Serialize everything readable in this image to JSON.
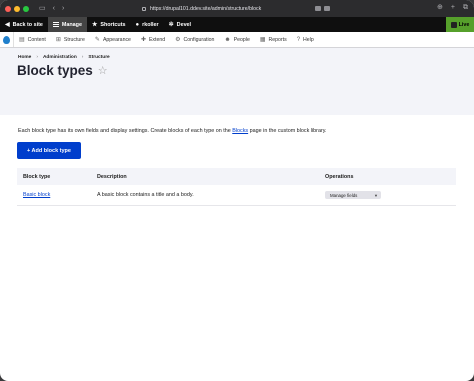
{
  "browser": {
    "url": "https://drupal101.ddev.site/admin/structure/block"
  },
  "toolbar": {
    "back_label": "Back to site",
    "manage_label": "Manage",
    "shortcuts_label": "Shortcuts",
    "user_label": "rkoller",
    "devel_label": "Devel",
    "live_label": "Live"
  },
  "admin_menu": [
    {
      "label": "Content",
      "icon": "content-icon"
    },
    {
      "label": "Structure",
      "icon": "structure-icon"
    },
    {
      "label": "Appearance",
      "icon": "appearance-icon"
    },
    {
      "label": "Extend",
      "icon": "extend-icon"
    },
    {
      "label": "Configuration",
      "icon": "configuration-icon"
    },
    {
      "label": "People",
      "icon": "people-icon"
    },
    {
      "label": "Reports",
      "icon": "reports-icon"
    },
    {
      "label": "Help",
      "icon": "help-icon"
    }
  ],
  "breadcrumb": [
    "Home",
    "Administration",
    "Structure"
  ],
  "page": {
    "title": "Block types",
    "description_before": "Each block type has its own fields and display settings. Create blocks of each type on the ",
    "description_link": "Blocks",
    "description_after": " page in the custom block library.",
    "add_button": "+ Add block type"
  },
  "table": {
    "headers": [
      "Block type",
      "Description",
      "Operations"
    ],
    "rows": [
      {
        "type": "Basic block",
        "description": "A basic block contains a title and a body.",
        "operation": "Manage fields"
      }
    ]
  },
  "colors": {
    "primary": "#003ecc",
    "live": "#56a02b"
  }
}
